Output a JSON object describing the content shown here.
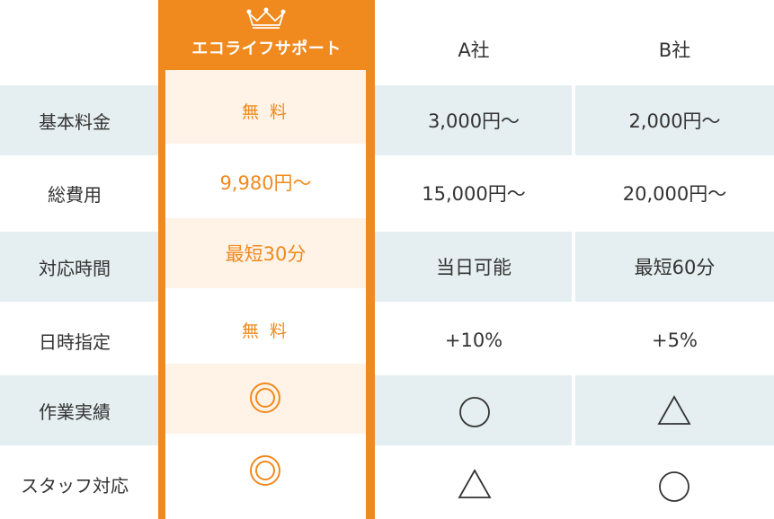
{
  "featured": {
    "name": "エコライフサポート",
    "values": [
      "無 料",
      "9,980円〜",
      "最短30分",
      "無 料",
      "◎",
      "◎"
    ]
  },
  "competitors": [
    {
      "name": "A社",
      "values": [
        "3,000円〜",
        "15,000円〜",
        "当日可能",
        "+10%",
        "○",
        "△"
      ]
    },
    {
      "name": "B社",
      "values": [
        "2,000円〜",
        "20,000円〜",
        "最短60分",
        "+5%",
        "△",
        "○"
      ]
    }
  ],
  "rows": [
    "基本料金",
    "総費用",
    "対応時間",
    "日時指定",
    "作業実績",
    "スタッフ対応"
  ],
  "colors": {
    "accent": "#f08a1f",
    "stripe": "#e5eef0",
    "text": "#333333"
  },
  "icons": {
    "crown": "crown-icon",
    "double_circle": "double-circle-icon",
    "circle": "circle-icon",
    "triangle": "triangle-icon"
  }
}
